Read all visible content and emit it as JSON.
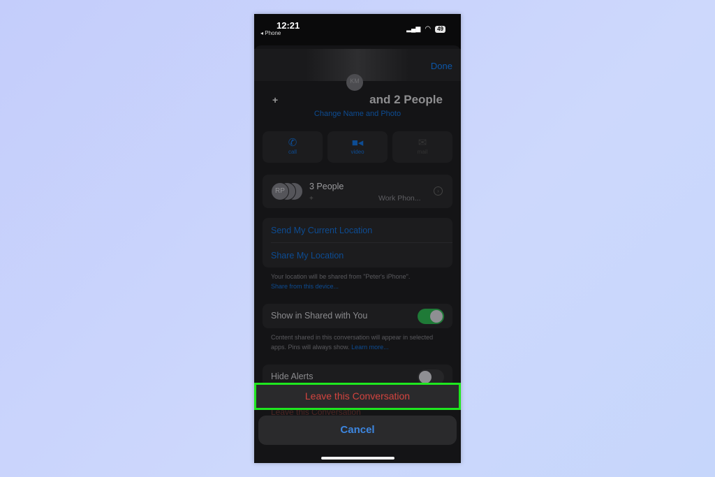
{
  "status_bar": {
    "time": "12:21",
    "back_label": "Phone",
    "battery": "49"
  },
  "header": {
    "done_label": "Done"
  },
  "contact": {
    "avatar_initials": "KM",
    "title_prefix": "+",
    "title": "and 2 People",
    "change_label": "Change Name and Photo"
  },
  "actions": [
    {
      "label": "call",
      "icon": "phone-icon"
    },
    {
      "label": "video",
      "icon": "video-icon"
    },
    {
      "label": "mail",
      "icon": "mail-icon"
    }
  ],
  "people": {
    "title": "3 People",
    "avatar_initials": "RP",
    "sub_prefix": "+",
    "detail": "Work Phon..."
  },
  "location": {
    "send": "Send My Current Location",
    "share": "Share My Location",
    "note": "Your location will be shared from \"Peter's iPhone\".",
    "note_link": "Share from this device..."
  },
  "shared": {
    "label": "Show in Shared with You",
    "on": true,
    "note": "Content shared in this conversation will appear in selected apps. Pins will always show.",
    "note_link": "Learn more..."
  },
  "hide_alerts": {
    "label": "Hide Alerts",
    "on": false
  },
  "action_sheet": {
    "leave_label": "Leave this Conversation",
    "ghost_label": "Leave this Conversation",
    "cancel_label": "Cancel"
  },
  "colors": {
    "highlight": "#1fe61f",
    "destructive": "#d4443f",
    "accent": "#3d86e0",
    "toggle_on": "#1f7a37"
  }
}
